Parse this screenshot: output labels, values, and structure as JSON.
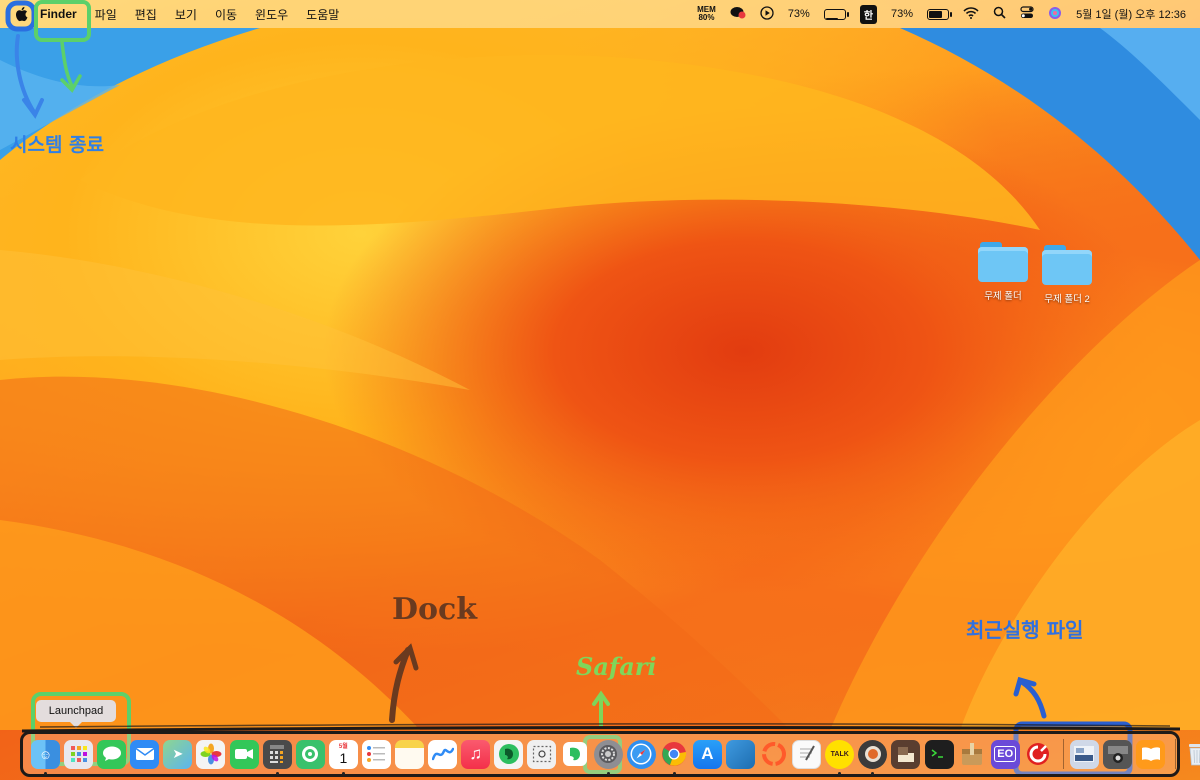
{
  "menubar": {
    "apple_icon": "apple-logo-icon",
    "app_name": "Finder",
    "menus": [
      "파일",
      "편집",
      "보기",
      "이동",
      "윈도우",
      "도움말"
    ],
    "mem_label": "MEM",
    "mem_value": "80%",
    "cpu_percent": "73%",
    "ime": "한",
    "battery_percent": "73%",
    "datetime": "5월 1일 (월) 오후 12:36"
  },
  "desktop": {
    "icons": [
      {
        "label": "무제 폴더",
        "icon": "folder-icon"
      },
      {
        "label": "무제 폴더 2",
        "icon": "folder-icon"
      }
    ]
  },
  "annotations": {
    "system_quit": "시스템 종료",
    "dock": "Dock",
    "safari": "Safari",
    "recent_files": "최근실행 파일"
  },
  "tooltip": {
    "label": "Launchpad"
  },
  "dock": {
    "calendar_month": "5월",
    "calendar_day": "1",
    "kakao_label": "TALK",
    "app_labels": [
      "EO"
    ],
    "apps": [
      {
        "name": "Finder",
        "icon": "finder-icon",
        "color": "#4aa3f0",
        "running": true
      },
      {
        "name": "Launchpad",
        "icon": "launchpad-icon",
        "color": "#e8e8ee",
        "running": false
      },
      {
        "name": "Messages",
        "icon": "messages-icon",
        "color": "#34c759",
        "running": false
      },
      {
        "name": "Mail",
        "icon": "mail-icon",
        "color": "#2f8bf5",
        "running": false
      },
      {
        "name": "Maps",
        "icon": "maps-icon",
        "color": "#6ec57e",
        "running": false
      },
      {
        "name": "Photos",
        "icon": "photos-icon",
        "color": "#f4f4f4",
        "running": false
      },
      {
        "name": "FaceTime",
        "icon": "facetime-icon",
        "color": "#32c759",
        "running": false
      },
      {
        "name": "Calculator",
        "icon": "calculator-icon",
        "color": "#4a4a4a",
        "running": true
      },
      {
        "name": "Find My",
        "icon": "findmy-icon",
        "color": "#39c16c",
        "running": false
      },
      {
        "name": "Calendar",
        "icon": "calendar-icon",
        "color": "#ffffff",
        "running": true
      },
      {
        "name": "Reminders",
        "icon": "reminders-icon",
        "color": "#ffffff",
        "running": false
      },
      {
        "name": "Notes",
        "icon": "notes-icon",
        "color": "#fff7d6",
        "running": false
      },
      {
        "name": "Freeform",
        "icon": "freeform-icon",
        "color": "#ffffff",
        "running": false
      },
      {
        "name": "Music",
        "icon": "music-icon",
        "color": "#fa3c5a",
        "running": false
      },
      {
        "name": "Evernote",
        "icon": "evernote-icon",
        "color": "#2dbe60",
        "running": false
      },
      {
        "name": "Screenshot",
        "icon": "screenshot-icon",
        "color": "#f0f0f0",
        "running": false
      },
      {
        "name": "System Settings",
        "icon": "settings-icon",
        "color": "#8e8e93",
        "running": true
      },
      {
        "name": "Safari",
        "icon": "safari-icon",
        "color": "#2f8ff0",
        "running": false
      },
      {
        "name": "Chrome",
        "icon": "chrome-icon",
        "color": "#f2f2f2",
        "running": true
      },
      {
        "name": "App Store",
        "icon": "appstore-icon",
        "color": "#1d8cf5",
        "running": false
      },
      {
        "name": "Preview",
        "icon": "preview-icon",
        "color": "#2a7fc9",
        "running": false
      },
      {
        "name": "Backup",
        "icon": "backup-icon",
        "color": "#ff6a3a",
        "running": false
      },
      {
        "name": "TextEdit",
        "icon": "textedit-icon",
        "color": "#fafafa",
        "running": false
      },
      {
        "name": "KakaoTalk",
        "icon": "kakaotalk-icon",
        "color": "#ffe000",
        "running": true
      },
      {
        "name": "Cooking",
        "icon": "pot-icon",
        "color": "#3b3b3b",
        "running": true
      },
      {
        "name": "Book",
        "icon": "book-icon",
        "color": "#5a3e30",
        "running": false
      },
      {
        "name": "Terminal",
        "icon": "terminal-icon",
        "color": "#1e1e1e",
        "running": false
      },
      {
        "name": "Archive",
        "icon": "archive-icon",
        "color": "#b58a4a",
        "running": false
      },
      {
        "name": "EO",
        "icon": "eo-icon",
        "color": "#6a4ad8",
        "running": false
      },
      {
        "name": "Pro App",
        "icon": "pro-app-icon",
        "color": "#e02020",
        "running": false
      }
    ],
    "recent": [
      {
        "name": "Recent Doc 1",
        "icon": "document-thumbnail-icon",
        "color": "#cfd8e8"
      },
      {
        "name": "Recent Doc 2",
        "icon": "camera-thumbnail-icon",
        "color": "#555555"
      },
      {
        "name": "Books",
        "icon": "books-icon",
        "color": "#ff9a1a"
      }
    ],
    "trash": {
      "name": "Trash",
      "icon": "trash-icon",
      "color": "#e8eef4"
    }
  }
}
